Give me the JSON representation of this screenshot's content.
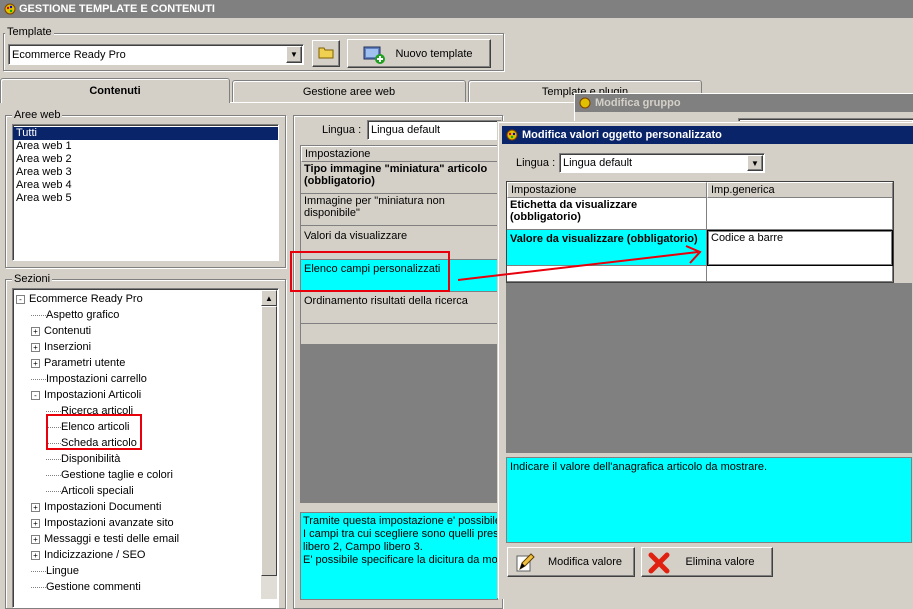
{
  "window": {
    "title": "GESTIONE TEMPLATE E CONTENUTI"
  },
  "template": {
    "label": "Template",
    "selected": "Ecommerce Ready Pro",
    "new_button": "Nuovo template"
  },
  "tabs": [
    "Contenuti",
    "Gestione aree web",
    "Template e plugin"
  ],
  "aree_web": {
    "label": "Aree web",
    "items": [
      "Tutti",
      "Area web 1",
      "Area web 2",
      "Area web 3",
      "Area web 4",
      "Area web 5"
    ]
  },
  "sezioni": {
    "label": "Sezioni",
    "items": [
      {
        "label": "Ecommerce Ready Pro",
        "exp": "-"
      },
      {
        "label": "Aspetto grafico",
        "exp": ""
      },
      {
        "label": "Contenuti",
        "exp": "+"
      },
      {
        "label": "Inserzioni",
        "exp": "+"
      },
      {
        "label": "Parametri utente",
        "exp": "+"
      },
      {
        "label": "Impostazioni carrello",
        "exp": ""
      },
      {
        "label": "Impostazioni Articoli",
        "exp": "-"
      },
      {
        "label": "Ricerca articoli",
        "exp": ""
      },
      {
        "label": "Elenco articoli",
        "exp": ""
      },
      {
        "label": "Scheda articolo",
        "exp": ""
      },
      {
        "label": "Disponibilità",
        "exp": ""
      },
      {
        "label": "Gestione taglie e colori",
        "exp": ""
      },
      {
        "label": "Articoli speciali",
        "exp": ""
      },
      {
        "label": "Impostazioni Documenti",
        "exp": "+"
      },
      {
        "label": "Impostazioni avanzate sito",
        "exp": "+"
      },
      {
        "label": "Messaggi e testi delle email",
        "exp": "+"
      },
      {
        "label": "Indicizzazione / SEO",
        "exp": "+"
      },
      {
        "label": "Lingue",
        "exp": ""
      },
      {
        "label": "Gestione commenti",
        "exp": ""
      }
    ]
  },
  "middle": {
    "lingua_label": "Lingua :",
    "lingua_value": "Lingua default",
    "col_header": "Impostazione",
    "rows": [
      "Tipo immagine \"miniatura\" articolo (obbligatorio)",
      "Immagine per \"miniatura non disponibile\"",
      "Valori da visualizzare",
      "Elenco campi personalizzati",
      "Ordinamento risultati della ricerca"
    ],
    "description": [
      "Tramite questa impostazione e' possibile",
      "I campi tra cui scegliere sono quelli prese",
      "libero 2, Campo libero 3.",
      "E' possibile specificare la dicitura da mos"
    ]
  },
  "dialog_group": {
    "title": "Modifica gruppo"
  },
  "dialog_values": {
    "title": "Modifica valori oggetto personalizzato",
    "lingua_label": "Lingua :",
    "lingua_value": "Lingua default",
    "col1": "Impostazione",
    "col2": "Imp.generica",
    "row1_label": "Etichetta da visualizzare (obbligatorio)",
    "row1_value": "",
    "row2_label": "Valore da visualizzare (obbligatorio)",
    "row2_value": "Codice a barre",
    "description": "Indicare il valore dell'anagrafica articolo da mostrare.",
    "modify_button": "Modifica valore",
    "delete_button": "Elimina valore"
  },
  "colors": {
    "highlight": "#00ffff",
    "selection": "#0a246a",
    "annotation": "#e8000b"
  }
}
